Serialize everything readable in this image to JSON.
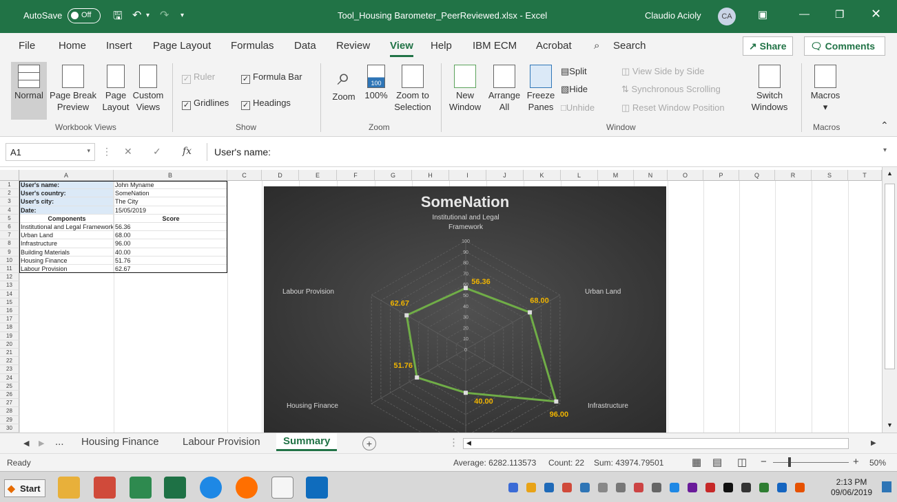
{
  "titlebar": {
    "autosave_label": "AutoSave",
    "autosave_state": "Off",
    "document_title": "Tool_Housing Barometer_PeerReviewed.xlsx  -  Excel",
    "user_name": "Claudio Acioly",
    "user_initials": "CA"
  },
  "menu": {
    "tabs": [
      "File",
      "Home",
      "Insert",
      "Page Layout",
      "Formulas",
      "Data",
      "Review",
      "View",
      "Help",
      "IBM ECM",
      "Acrobat"
    ],
    "search_label": "Search",
    "share_label": "Share",
    "comments_label": "Comments",
    "active_tab": "View"
  },
  "ribbon": {
    "workbook_views": {
      "normal": "Normal",
      "page_break_l1": "Page Break",
      "page_break_l2": "Preview",
      "page_layout_l1": "Page",
      "page_layout_l2": "Layout",
      "custom_l1": "Custom",
      "custom_l2": "Views",
      "group": "Workbook Views"
    },
    "show": {
      "ruler": "Ruler",
      "formula_bar": "Formula Bar",
      "gridlines": "Gridlines",
      "headings": "Headings",
      "group": "Show"
    },
    "zoom": {
      "zoom": "Zoom",
      "hundred": "100%",
      "zoom_sel_l1": "Zoom to",
      "zoom_sel_l2": "Selection",
      "group": "Zoom",
      "icon_label": "100"
    },
    "window": {
      "new_l1": "New",
      "new_l2": "Window",
      "arrange_l1": "Arrange",
      "arrange_l2": "All",
      "freeze_l1": "Freeze",
      "freeze_l2": "Panes",
      "split": "Split",
      "hide": "Hide",
      "unhide": "Unhide",
      "side_by_side": "View Side by Side",
      "sync_scroll": "Synchronous Scrolling",
      "reset_pos": "Reset Window Position",
      "switch_l1": "Switch",
      "switch_l2": "Windows",
      "group": "Window"
    },
    "macros": {
      "macros": "Macros",
      "group": "Macros"
    }
  },
  "formula_bar": {
    "name_box": "A1",
    "fx": "fx",
    "content": "User's name:"
  },
  "columns": [
    "A",
    "B",
    "C",
    "D",
    "E",
    "F",
    "G",
    "H",
    "I",
    "J",
    "K",
    "L",
    "M",
    "N",
    "O",
    "P",
    "Q",
    "R",
    "S",
    "T"
  ],
  "rows": [
    "1",
    "2",
    "3",
    "4",
    "5",
    "6",
    "7",
    "8",
    "9",
    "10",
    "11",
    "12",
    "13",
    "14",
    "15",
    "16",
    "17",
    "18",
    "19",
    "20",
    "21",
    "22",
    "23",
    "24",
    "25",
    "26",
    "27",
    "28",
    "29",
    "30"
  ],
  "sheet": {
    "info": [
      {
        "label": "User's name:",
        "value": "John Myname"
      },
      {
        "label": "User's country:",
        "value": "SomeNation"
      },
      {
        "label": "User's city:",
        "value": "The City"
      },
      {
        "label": "Date:",
        "value": "15/05/2019"
      }
    ],
    "table_headers": [
      "Components",
      "Score"
    ],
    "components": [
      {
        "name": "Institutional and Legal Framework",
        "score": "56.36"
      },
      {
        "name": "Urban Land",
        "score": "68.00"
      },
      {
        "name": "Infrastructure",
        "score": "96.00"
      },
      {
        "name": "Building Materials",
        "score": "40.00"
      },
      {
        "name": "Housing Finance",
        "score": "51.76"
      },
      {
        "name": "Labour Provision",
        "score": "62.67"
      }
    ]
  },
  "chart_data": {
    "type": "radar",
    "title": "SomeNation",
    "categories": [
      "Institutional and Legal Framework",
      "Urban Land",
      "Infrastructure",
      "Building Materials",
      "Housing Finance",
      "Labour Provision"
    ],
    "values": [
      56.36,
      68.0,
      96.0,
      40.0,
      51.76,
      62.67
    ],
    "value_labels": [
      "56.36",
      "68.00",
      "96.00",
      "40.00",
      "51.76",
      "62.67"
    ],
    "axis_ticks": [
      "0",
      "10",
      "20",
      "30",
      "40",
      "50",
      "60",
      "70",
      "80",
      "90",
      "100"
    ],
    "ylim": [
      0,
      100
    ],
    "colors": {
      "line": "#70ad47",
      "labels": "#f0b400",
      "background": "#3a3a3a"
    }
  },
  "sheet_tabs": {
    "ellipsis": "...",
    "tabs": [
      "Housing Finance",
      "Labour Provision",
      "Summary"
    ],
    "active": "Summary",
    "add": "+"
  },
  "status": {
    "ready": "Ready",
    "average": "Average: 6282.113573",
    "count": "Count: 22",
    "sum": "Sum: 43974.79501",
    "zoom": "50%"
  },
  "taskbar": {
    "start": "Start",
    "time": "2:13 PM",
    "date": "09/06/2019"
  }
}
